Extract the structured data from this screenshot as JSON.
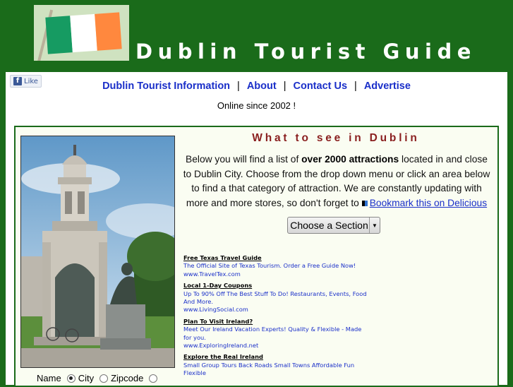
{
  "header": {
    "title": "Dublin Tourist Guide",
    "flag_colors": [
      "#169b62",
      "#ffffff",
      "#ff883e"
    ]
  },
  "social": {
    "like_label": "Like",
    "icon": "facebook-icon"
  },
  "nav": {
    "items": [
      {
        "label": "Dublin Tourist Information"
      },
      {
        "label": "About"
      },
      {
        "label": "Contact Us"
      },
      {
        "label": "Advertise"
      }
    ],
    "separator": "|"
  },
  "online_text": "Online since 2002 !",
  "main": {
    "heading": "What to see in Dublin",
    "intro_before": "Below you will find a list of ",
    "intro_bold": "over 2000 attractions",
    "intro_after": " located in and close to Dublin City. Choose from the drop down menu or click an area below to find a that category of attraction. We are constantly updating with more and more stores, so don't forget to ",
    "bookmark_label": "Bookmark this on Delicious",
    "select_label": "Choose a Section"
  },
  "search_by": {
    "label": "Name",
    "options": [
      {
        "label": "City",
        "checked": true
      },
      {
        "label": "Zipcode",
        "checked": false
      }
    ]
  },
  "ads": [
    {
      "title": "Free Texas Travel Guide",
      "text": "The Official Site of Texas Tourism. Order a Free Guide Now!",
      "url": "www.TravelTex.com"
    },
    {
      "title": "Local 1-Day Coupons",
      "text": "Up To 90% Off The Best Stuff To Do! Restaurants, Events, Food And More.",
      "url": "www.LivingSocial.com"
    },
    {
      "title": "Plan To Visit Ireland?",
      "text": "Meet Our Ireland Vacation Experts! Quality & Flexible - Made for you.",
      "url": "www.ExploringIreland.net"
    },
    {
      "title": "Explore the Real Ireland",
      "text": "Small Group Tours Back Roads Small Towns Affordable Fun Flexible",
      "url": ""
    }
  ]
}
